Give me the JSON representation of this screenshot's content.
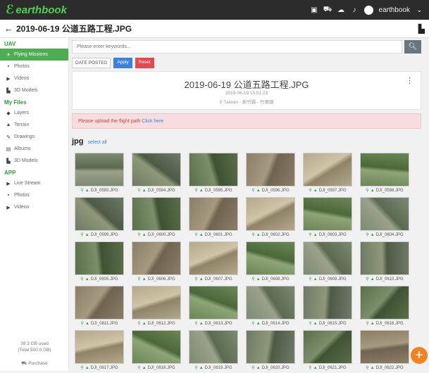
{
  "app": {
    "logo_text": "earthbook",
    "user_name": "earthbook"
  },
  "title": "2019-06-19 公道五路工程.JPG",
  "sidebar": {
    "sections": [
      {
        "title": "UAV",
        "items": [
          {
            "label": "Flying Missions",
            "icon": "drone-icon",
            "active": true
          },
          {
            "label": "Photos",
            "icon": "photo-icon"
          },
          {
            "label": "Videos",
            "icon": "video-icon"
          },
          {
            "label": "3D Models",
            "icon": "building-icon"
          }
        ]
      },
      {
        "title": "My Files",
        "items": [
          {
            "label": "Layers",
            "icon": "layers-icon"
          },
          {
            "label": "Terrain",
            "icon": "terrain-icon"
          },
          {
            "label": "Drawings",
            "icon": "pencil-icon"
          },
          {
            "label": "Albums",
            "icon": "album-icon"
          },
          {
            "label": "3D Models",
            "icon": "building-icon"
          }
        ]
      },
      {
        "title": "APP",
        "items": [
          {
            "label": "Live Stream",
            "icon": "video-icon"
          },
          {
            "label": "Photos",
            "icon": "photo-icon"
          },
          {
            "label": "Videos",
            "icon": "video-icon"
          }
        ]
      }
    ],
    "storage_used": "39.3 GB used",
    "storage_total": "(Total 500.0 GB)",
    "purchase_label": "Purchase"
  },
  "search": {
    "placeholder": "Please enter keywords..."
  },
  "filters": {
    "date_label": "DATE POSTED",
    "apply_label": "Apply",
    "reset_label": "Reset"
  },
  "card": {
    "title": "2019-06-19 公道五路工程.JPG",
    "date": "2019-06-19 15:51:23",
    "location": "Taiwan - 新竹縣 - 竹東鎮"
  },
  "alert": {
    "text": "Please upload the flight path ",
    "link": "Click here"
  },
  "section": {
    "format": "jpg",
    "select_all": "select all"
  },
  "photos": [
    "DJI_0593.JPG",
    "DJI_0594.JPG",
    "DJI_0595.JPG",
    "DJI_0596.JPG",
    "DJI_0597.JPG",
    "DJI_0598.JPG",
    "DJI_0599.JPG",
    "DJI_0600.JPG",
    "DJI_0601.JPG",
    "DJI_0602.JPG",
    "DJI_0603.JPG",
    "DJI_0604.JPG",
    "DJI_0605.JPG",
    "DJI_0606.JPG",
    "DJI_0607.JPG",
    "DJI_0608.JPG",
    "DJI_0609.JPG",
    "DJI_0610.JPG",
    "DJI_0611.JPG",
    "DJI_0612.JPG",
    "DJI_0613.JPG",
    "DJI_0614.JPG",
    "DJI_0615.JPG",
    "DJI_0616.JPG",
    "DJI_0617.JPG",
    "DJI_0618.JPG",
    "DJI_0619.JPG",
    "DJI_0620.JPG",
    "DJI_0621.JPG",
    "DJI_0622.JPG"
  ],
  "colors": {
    "accent": "#4cae50",
    "apply": "#3a82db",
    "reset": "#e54850",
    "fab": "#f58220"
  }
}
